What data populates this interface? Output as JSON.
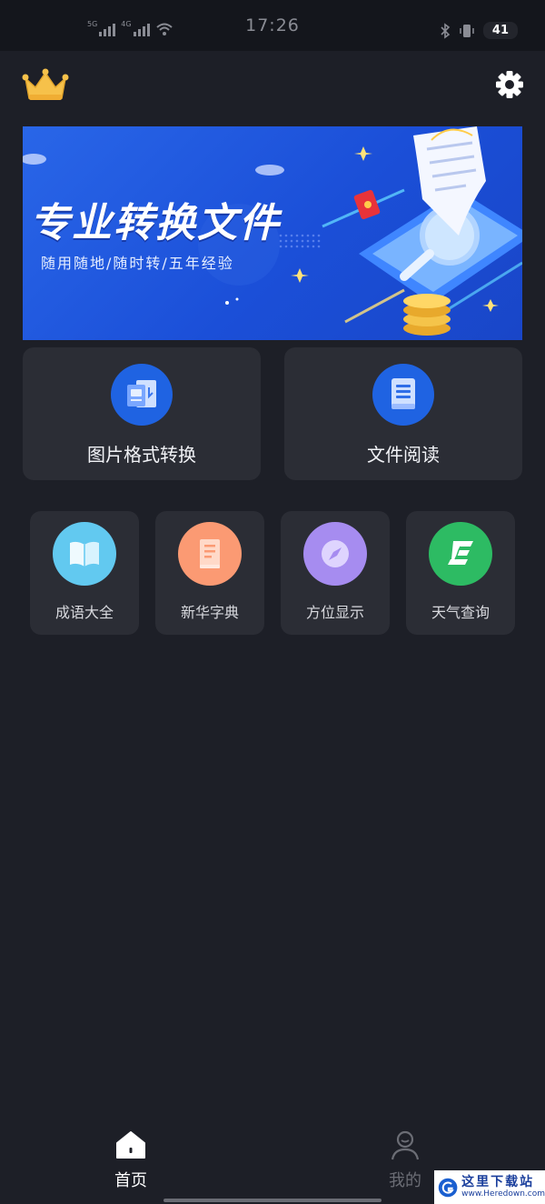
{
  "status_bar": {
    "time": "17:26",
    "battery": "41",
    "signal_labels": [
      "5G",
      "4G"
    ]
  },
  "header": {
    "left_icon": "crown-icon",
    "right_icon": "gear-icon"
  },
  "banner": {
    "title": "专业转换文件",
    "subtitle": "随用随地/随时转/五年经验"
  },
  "main_features": [
    {
      "label": "图片格式转换",
      "icon": "image-convert-icon",
      "color": "#1f63e2"
    },
    {
      "label": "文件阅读",
      "icon": "document-icon",
      "color": "#1f63e2"
    }
  ],
  "tools": [
    {
      "label": "成语大全",
      "icon": "book-icon",
      "color": "#62c9f0"
    },
    {
      "label": "新华字典",
      "icon": "dictionary-icon",
      "color": "#fb9a73"
    },
    {
      "label": "方位显示",
      "icon": "compass-icon",
      "color": "#a68cf0"
    },
    {
      "label": "天气查询",
      "icon": "weather-icon",
      "color": "#2dbb63"
    }
  ],
  "tab_bar": {
    "tabs": [
      {
        "label": "首页",
        "icon": "home-icon",
        "active": true
      },
      {
        "label": "我的",
        "icon": "user-icon",
        "active": false
      }
    ]
  },
  "watermark": {
    "cn": "这里下载站",
    "en": "www.Heredown.com"
  },
  "colors": {
    "background": "#1d1f27",
    "card": "#2b2d35",
    "accent": "#1f63e2"
  }
}
